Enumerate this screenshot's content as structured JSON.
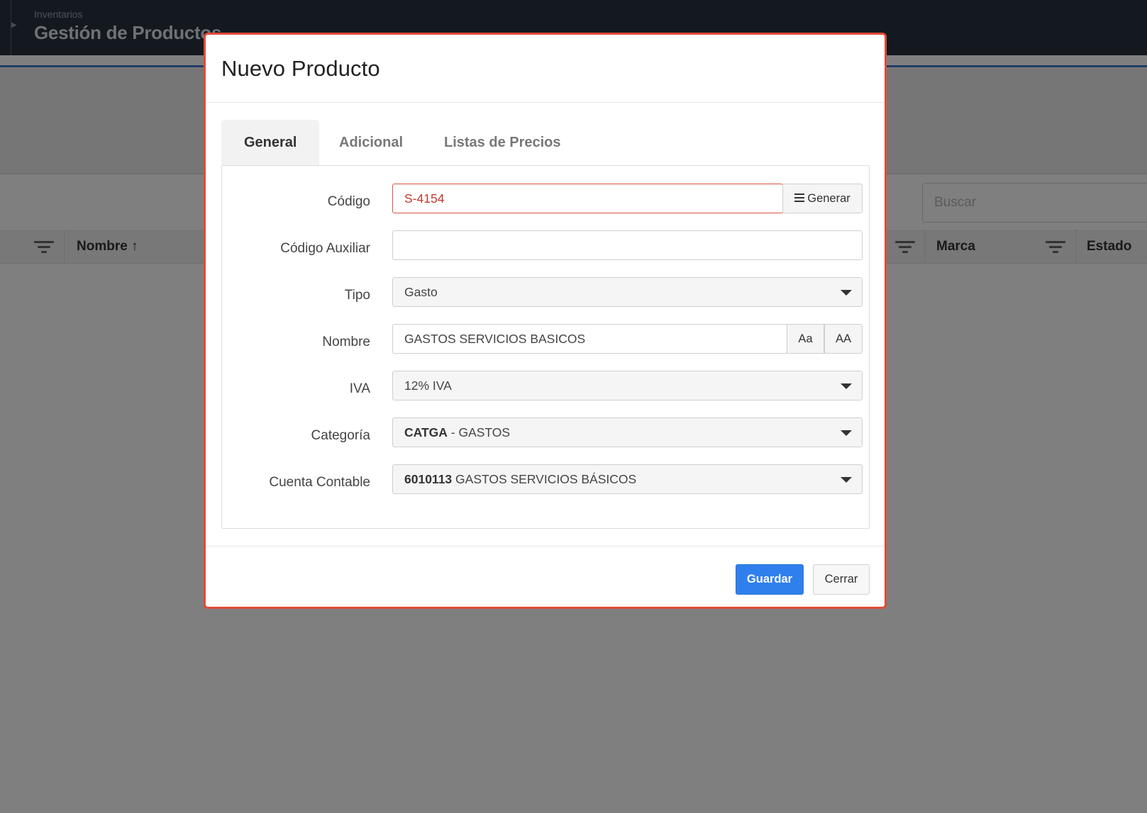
{
  "app": {
    "breadcrumb": "Inventarios",
    "title": "Gestión de Productos",
    "search_placeholder": "Buscar",
    "columns": [
      "Nombre ↑",
      "Marca",
      "Estado"
    ]
  },
  "modal": {
    "title": "Nuevo Producto",
    "tabs": [
      "General",
      "Adicional",
      "Listas de Precios"
    ],
    "active_tab": "General",
    "fields": {
      "codigo": {
        "label": "Código",
        "value": "S-4154",
        "button": "Generar"
      },
      "codigo_auxiliar": {
        "label": "Código Auxiliar",
        "value": ""
      },
      "tipo": {
        "label": "Tipo",
        "value": "Gasto"
      },
      "nombre": {
        "label": "Nombre",
        "value": "GASTOS SERVICIOS BASICOS",
        "btn_title_case": "Aa",
        "btn_upper_case": "AA"
      },
      "iva": {
        "label": "IVA",
        "value": "12% IVA"
      },
      "categoria": {
        "label": "Categoría",
        "code": "CATGA",
        "name": " - GASTOS"
      },
      "cuenta_contable": {
        "label": "Cuenta Contable",
        "code": "6010113",
        "name": " GASTOS SERVICIOS BÁSICOS"
      }
    },
    "buttons": {
      "save": "Guardar",
      "close": "Cerrar"
    }
  },
  "colors": {
    "topbar": "#283340",
    "modal_border": "#e34a36",
    "primary": "#2f80ed",
    "error": "#d9553f"
  }
}
